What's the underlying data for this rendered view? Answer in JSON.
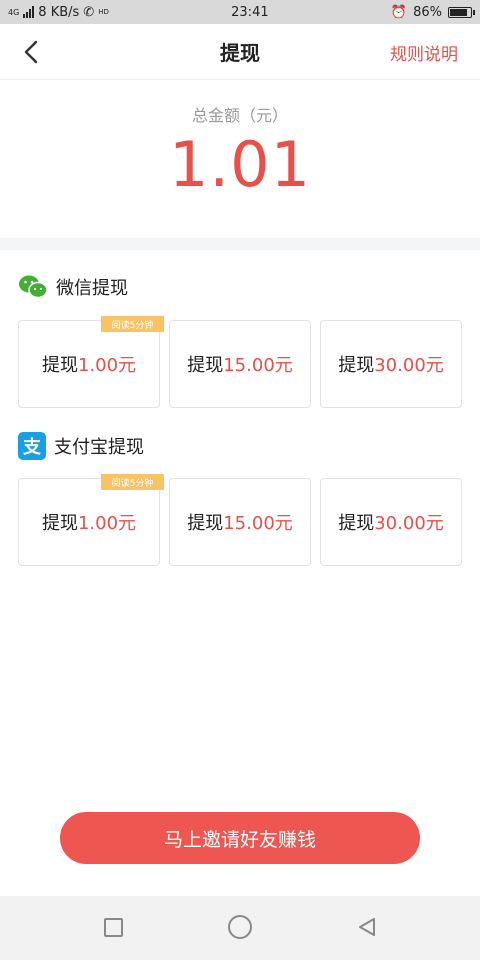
{
  "status_bar": {
    "network": "4G",
    "speed": "8 KB/s",
    "hd": "HD",
    "time": "23:41",
    "battery": "86%"
  },
  "nav": {
    "title": "提现",
    "rules_label": "规则说明",
    "back_icon": "chevron-left-icon"
  },
  "balance": {
    "label": "总金额（元）",
    "amount": "1.01"
  },
  "wechat": {
    "title": "微信提现",
    "icon": "wechat-icon",
    "badge": "阅读5分钟",
    "options": [
      {
        "label": "提现",
        "amount": "1.00元"
      },
      {
        "label": "提现",
        "amount": "15.00元"
      },
      {
        "label": "提现",
        "amount": "30.00元"
      }
    ]
  },
  "alipay": {
    "title": "支付宝提现",
    "icon": "alipay-icon",
    "icon_glyph": "支",
    "badge": "阅读5分钟",
    "options": [
      {
        "label": "提现",
        "amount": "1.00元"
      },
      {
        "label": "提现",
        "amount": "15.00元"
      },
      {
        "label": "提现",
        "amount": "30.00元"
      }
    ]
  },
  "invite_button": "马上邀请好友赚钱",
  "colors": {
    "accent": "#e8504a",
    "wechat_green": "#41b035",
    "alipay_blue": "#1a9fe3",
    "badge": "#f9c363"
  }
}
